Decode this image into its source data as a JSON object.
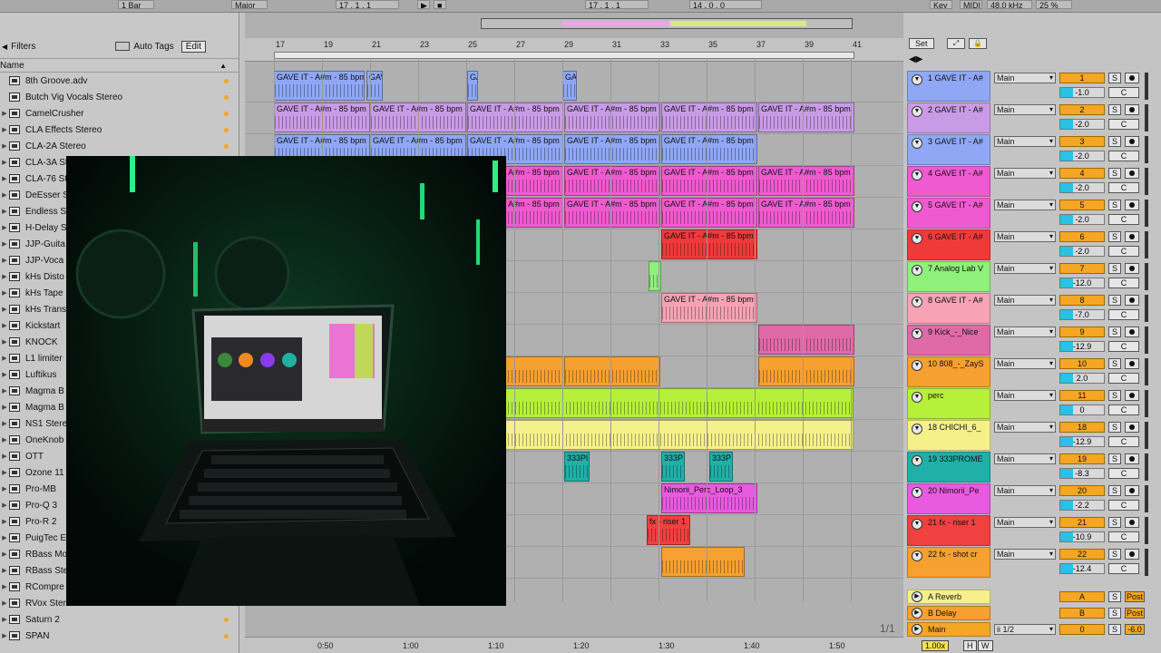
{
  "topbar": {
    "items": [
      "1 Bar",
      "Major",
      "17 . 1 . 1",
      "17 . 1 . 1",
      "14 . 0 . 0",
      "Key",
      "MIDI",
      "48.0 kHz",
      "25 %"
    ]
  },
  "browser": {
    "filters": "Filters",
    "autotags": "Auto Tags",
    "edit": "Edit",
    "col_name": "Name",
    "items": [
      "8th Groove.adv",
      "Butch Vig Vocals Stereo",
      "CamelCrusher",
      "CLA Effects Stereo",
      "CLA-2A Stereo",
      "CLA-3A St",
      "CLA-76 St",
      "DeEsser S",
      "Endless S",
      "H-Delay S",
      "JJP-Guita",
      "JJP-Voca",
      "kHs Disto",
      "kHs Tape",
      "kHs Trans",
      "Kickstart",
      "KNOCK",
      "L1 limiter",
      "Luftikus",
      "Magma B",
      "Magma B",
      "NS1 Stere",
      "OneKnob",
      "OTT",
      "Ozone 11",
      "Pro-MB",
      "Pro-Q 3",
      "Pro-R 2",
      "PuigTec E",
      "RBass Mo",
      "RBass Ste",
      "RCompre",
      "RVox Stereo",
      "Saturn 2",
      "SPAN"
    ]
  },
  "arrange": {
    "bars": [
      "17",
      "19",
      "21",
      "23",
      "25",
      "27",
      "29",
      "31",
      "33",
      "35",
      "37",
      "39",
      "41"
    ],
    "times": [
      "0:50",
      "1:00",
      "1:10",
      "1:20",
      "1:30",
      "1:40",
      "1:50"
    ],
    "clip_label": "GAVE IT - A#m - 85 bpm",
    "clip_short": "GAV",
    "c333": "333P",
    "c333b": "333Pl",
    "perc_loop": "Nimorii_Perc_Loop_3",
    "riser": "fx - riser 1",
    "zoom": "1/1"
  },
  "mixer": {
    "set": "Set",
    "tracks": [
      {
        "name": "1 GAVE IT - A#",
        "route": "Main",
        "num": "1",
        "vol": "-1.0",
        "color": "#8fa7f5"
      },
      {
        "name": "2 GAVE IT - A#",
        "route": "Main",
        "num": "2",
        "vol": "-2.0",
        "color": "#c99be6"
      },
      {
        "name": "3 GAVE IT - A#",
        "route": "Main",
        "num": "3",
        "vol": "-2.0",
        "color": "#8fa7f5"
      },
      {
        "name": "4 GAVE IT - A#",
        "route": "Main",
        "num": "4",
        "vol": "-2.0",
        "color": "#f05ad0"
      },
      {
        "name": "5 GAVE IT - A#",
        "route": "Main",
        "num": "5",
        "vol": "-2.0",
        "color": "#f05ad0"
      },
      {
        "name": "6 GAVE IT - A#",
        "route": "Main",
        "num": "6",
        "vol": "-2.0",
        "color": "#f03a3a"
      },
      {
        "name": "7 Analog Lab V",
        "route": "Main",
        "num": "7",
        "vol": "-12.0",
        "color": "#8ff07a"
      },
      {
        "name": "8 GAVE IT - A#",
        "route": "Main",
        "num": "8",
        "vol": "-7.0",
        "color": "#f5a3b5"
      },
      {
        "name": "9 Kick_-_Nice",
        "route": "Main",
        "num": "9",
        "vol": "-12.9",
        "color": "#e06aa8"
      },
      {
        "name": "10 808_-_ZayS",
        "route": "Main",
        "num": "10",
        "vol": "2.0",
        "color": "#f5a030"
      },
      {
        "name": "perc",
        "route": "Main",
        "num": "11",
        "vol": "0",
        "color": "#b6f03a"
      },
      {
        "name": "18 CHICHI_6_",
        "route": "Main",
        "num": "18",
        "vol": "-12.9",
        "color": "#f5f08a"
      },
      {
        "name": "19 333PROME",
        "route": "Main",
        "num": "19",
        "vol": "-8.3",
        "color": "#20b0a8"
      },
      {
        "name": "20 Nimorii_Pe",
        "route": "Main",
        "num": "20",
        "vol": "-2.2",
        "color": "#e85ae0"
      },
      {
        "name": "21 fx - riser 1",
        "route": "Main",
        "num": "21",
        "vol": "-10.9",
        "color": "#f04040"
      },
      {
        "name": "22 fx - shot cr",
        "route": "Main",
        "num": "22",
        "vol": "-12.4",
        "color": "#f5a030"
      }
    ],
    "returns": [
      {
        "name": "A Reverb",
        "num": "A",
        "btn": "Post",
        "color": "#f5f08a"
      },
      {
        "name": "B Delay",
        "num": "B",
        "btn": "Post",
        "color": "#f5a030"
      },
      {
        "name": "Main",
        "num": "0",
        "btn": "-6.0",
        "route": "ii 1/2",
        "color": "#f5a623"
      }
    ],
    "zoom": "1.00x",
    "h": "H",
    "w": "W"
  }
}
